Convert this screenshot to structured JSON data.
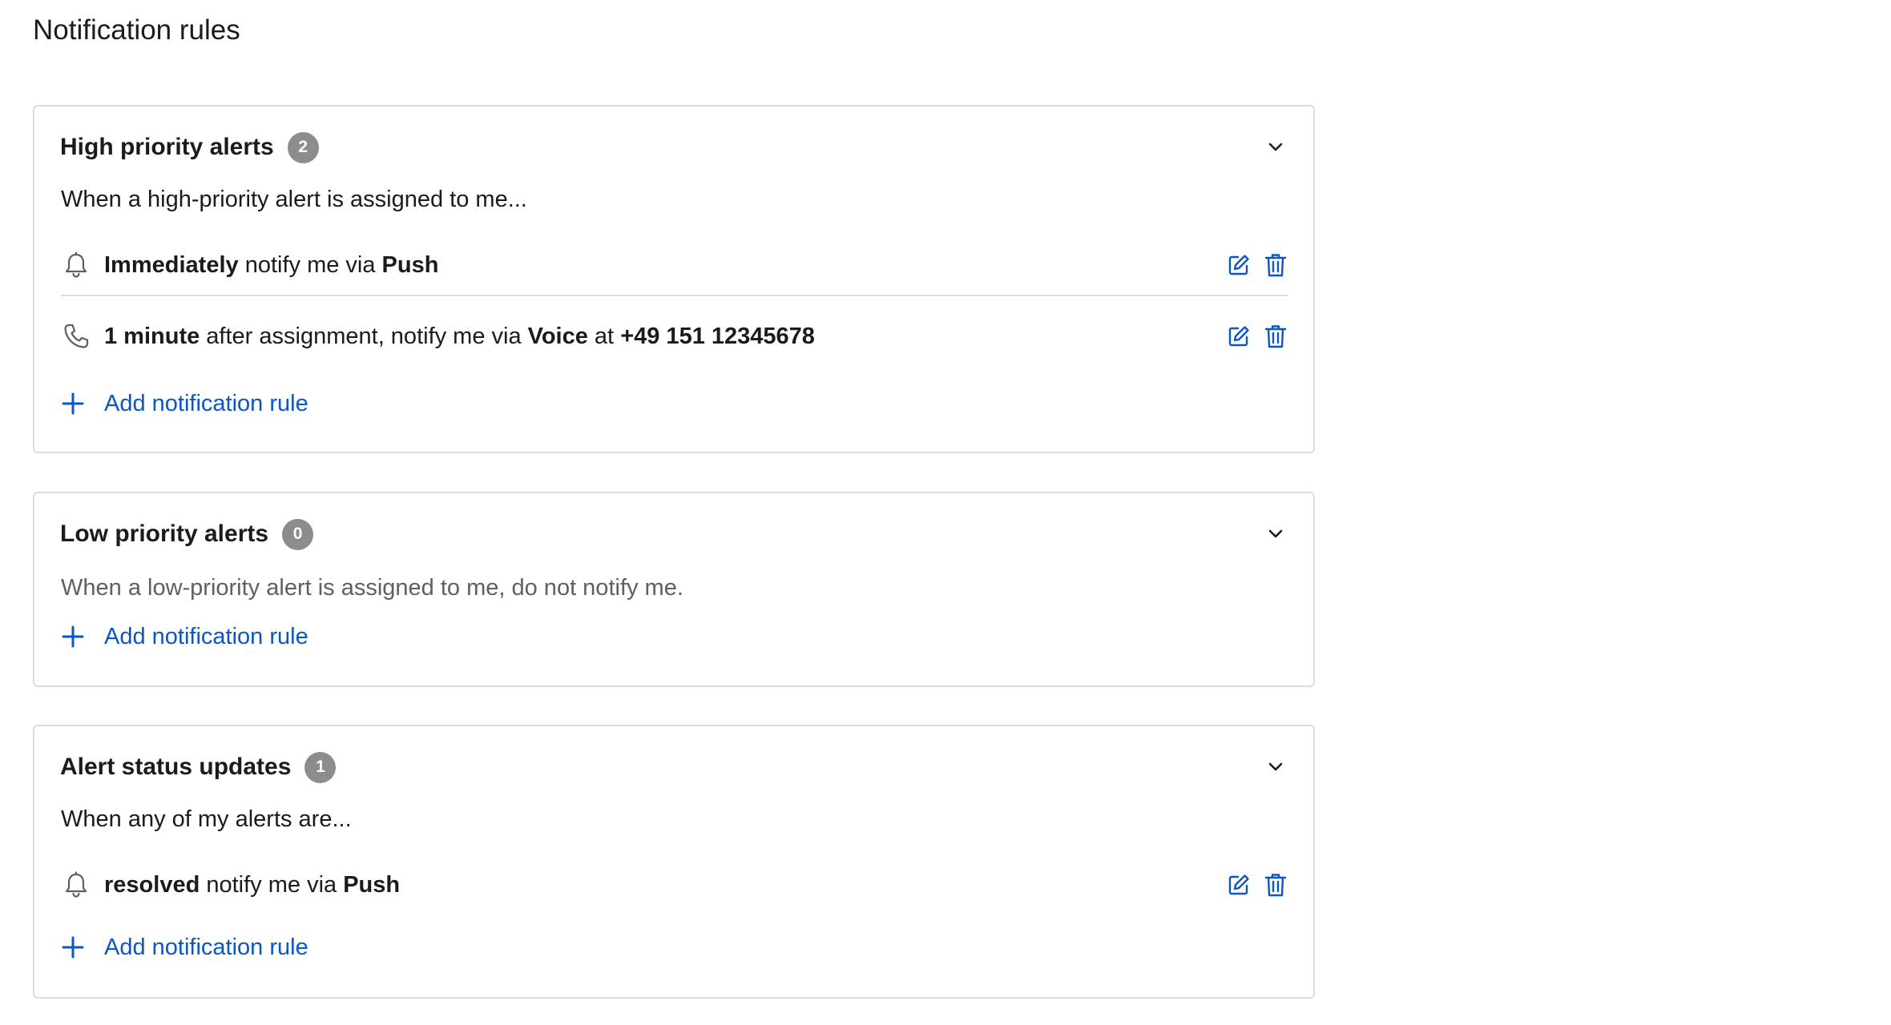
{
  "page": {
    "title": "Notification rules"
  },
  "colors": {
    "accent": "#0a57c2",
    "badge": "#8c8c8c",
    "border": "#dcdcdc",
    "text": "#1b1b1b",
    "muted_text": "#5f5f5f"
  },
  "sections": {
    "high": {
      "title": "High priority alerts",
      "count": "2",
      "description": "When a high-priority alert is assigned to me...",
      "rules": [
        {
          "icon": "bell-icon",
          "parts": [
            {
              "text": "Immediately",
              "bold": true
            },
            {
              "text": " notify me via ",
              "bold": false
            },
            {
              "text": "Push",
              "bold": true
            }
          ]
        },
        {
          "icon": "phone-icon",
          "parts": [
            {
              "text": "1 minute",
              "bold": true
            },
            {
              "text": " after assignment, notify me via ",
              "bold": false
            },
            {
              "text": "Voice",
              "bold": true
            },
            {
              "text": " at ",
              "bold": false
            },
            {
              "text": "+49 151 12345678",
              "bold": true
            }
          ]
        }
      ],
      "add_label": "Add notification rule"
    },
    "low": {
      "title": "Low priority alerts",
      "count": "0",
      "description": "When a low-priority alert is assigned to me, do not notify me.",
      "add_label": "Add notification rule"
    },
    "status": {
      "title": "Alert status updates",
      "count": "1",
      "description": "When any of my alerts are...",
      "rules": [
        {
          "icon": "bell-icon",
          "parts": [
            {
              "text": "resolved",
              "bold": true
            },
            {
              "text": " notify me via ",
              "bold": false
            },
            {
              "text": "Push",
              "bold": true
            }
          ]
        }
      ],
      "add_label": "Add notification rule"
    }
  }
}
